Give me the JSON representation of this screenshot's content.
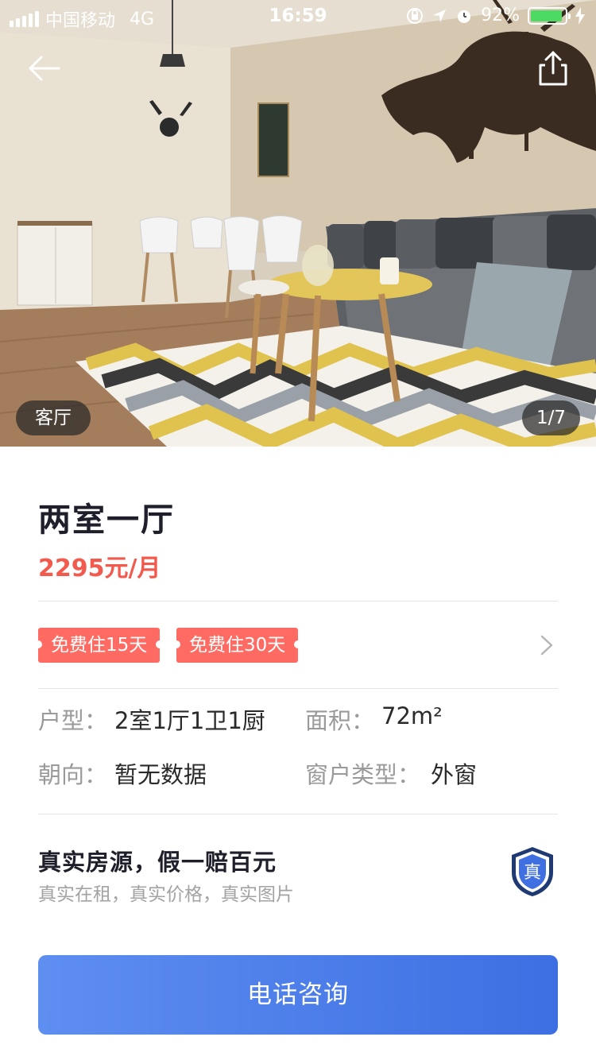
{
  "status_bar": {
    "carrier": "中国移动",
    "network": "4G",
    "time": "16:59",
    "battery_percent_label": "92%",
    "battery_level": 0.92
  },
  "gallery": {
    "room_label": "客厅",
    "photo_counter": "1/7",
    "accent_rug_colors": [
      "#e0c24e",
      "#3a3a3a",
      "#9aa0a8",
      "#ffffff"
    ]
  },
  "listing": {
    "title": "两室一厅",
    "price": "2295元/月",
    "promo_tags": [
      "免费住15天",
      "免费住30天"
    ],
    "details": {
      "layout_label": "户型：",
      "layout_value": "2室1厅1卫1厨",
      "area_label": "面积：",
      "area_value": "72m²",
      "orientation_label": "朝向：",
      "orientation_value": "暂无数据",
      "window_label": "窗户类型：",
      "window_value": "外窗"
    },
    "guarantee": {
      "title": "真实房源，假一赔百元",
      "subtitle": "真实在租，真实价格，真实图片",
      "badge_text": "真"
    },
    "cta_label": "电话咨询"
  },
  "colors": {
    "price": "#f15a4d",
    "tag_bg": "#ff6b62",
    "cta_start": "#5e8ef0",
    "cta_end": "#3d6fe3",
    "badge_blue": "#3f6fe0",
    "badge_navy": "#1f3a73"
  }
}
